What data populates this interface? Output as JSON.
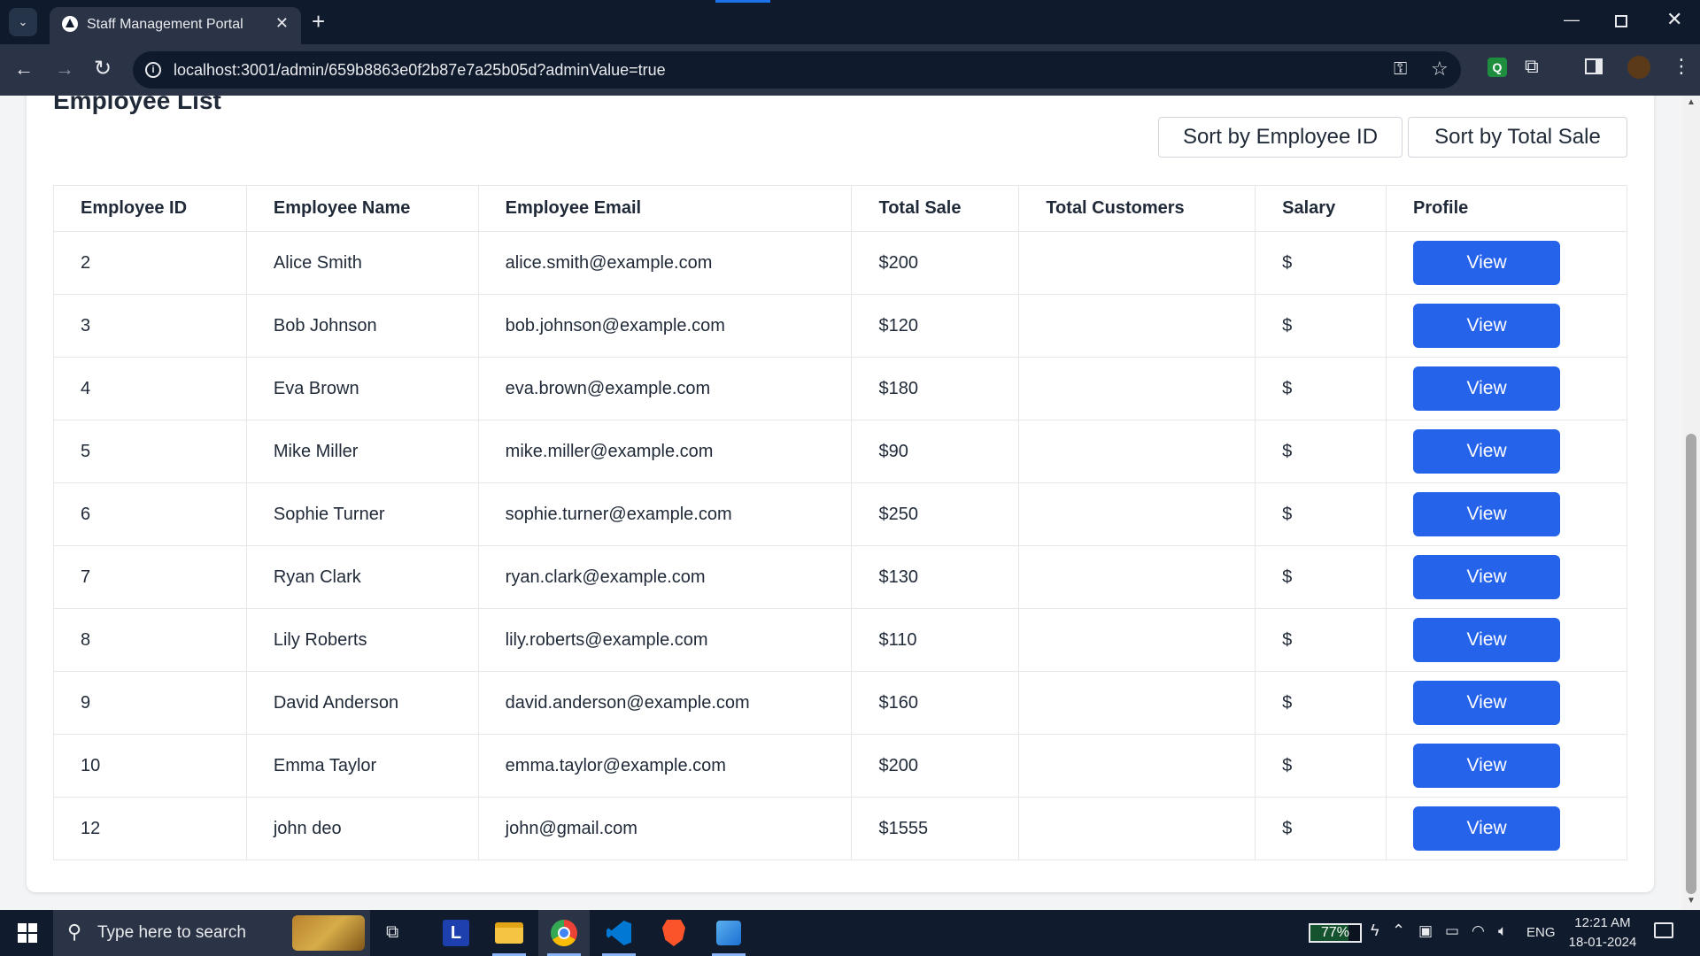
{
  "browser": {
    "tab_title": "Staff Management Portal",
    "url": "localhost:3001/admin/659b8863e0f2b87e7a25b05d?adminValue=true"
  },
  "page": {
    "title": "Employee List",
    "sort_by_id_label": "Sort by Employee ID",
    "sort_by_sale_label": "Sort by Total Sale"
  },
  "table": {
    "headers": [
      "Employee ID",
      "Employee Name",
      "Employee Email",
      "Total Sale",
      "Total Customers",
      "Salary",
      "Profile"
    ],
    "rows": [
      {
        "id": "2",
        "name": "Alice Smith",
        "email": "alice.smith@example.com",
        "sale": "$200",
        "customers": "",
        "salary": "$",
        "action": "View"
      },
      {
        "id": "3",
        "name": "Bob Johnson",
        "email": "bob.johnson@example.com",
        "sale": "$120",
        "customers": "",
        "salary": "$",
        "action": "View"
      },
      {
        "id": "4",
        "name": "Eva Brown",
        "email": "eva.brown@example.com",
        "sale": "$180",
        "customers": "",
        "salary": "$",
        "action": "View"
      },
      {
        "id": "5",
        "name": "Mike Miller",
        "email": "mike.miller@example.com",
        "sale": "$90",
        "customers": "",
        "salary": "$",
        "action": "View"
      },
      {
        "id": "6",
        "name": "Sophie Turner",
        "email": "sophie.turner@example.com",
        "sale": "$250",
        "customers": "",
        "salary": "$",
        "action": "View"
      },
      {
        "id": "7",
        "name": "Ryan Clark",
        "email": "ryan.clark@example.com",
        "sale": "$130",
        "customers": "",
        "salary": "$",
        "action": "View"
      },
      {
        "id": "8",
        "name": "Lily Roberts",
        "email": "lily.roberts@example.com",
        "sale": "$110",
        "customers": "",
        "salary": "$",
        "action": "View"
      },
      {
        "id": "9",
        "name": "David Anderson",
        "email": "david.anderson@example.com",
        "sale": "$160",
        "customers": "",
        "salary": "$",
        "action": "View"
      },
      {
        "id": "10",
        "name": "Emma Taylor",
        "email": "emma.taylor@example.com",
        "sale": "$200",
        "customers": "",
        "salary": "$",
        "action": "View"
      },
      {
        "id": "12",
        "name": "john deo",
        "email": "john@gmail.com",
        "sale": "$1555",
        "customers": "",
        "salary": "$",
        "action": "View"
      }
    ]
  },
  "taskbar": {
    "search_placeholder": "Type here to search",
    "battery": "77%",
    "battery_level": 0.77,
    "language": "ENG",
    "time": "12:21 AM",
    "date": "18-01-2024"
  },
  "colors": {
    "accent": "#2563eb",
    "chrome_dark": "#0f1a2c",
    "chrome_toolbar": "#2a3446"
  }
}
